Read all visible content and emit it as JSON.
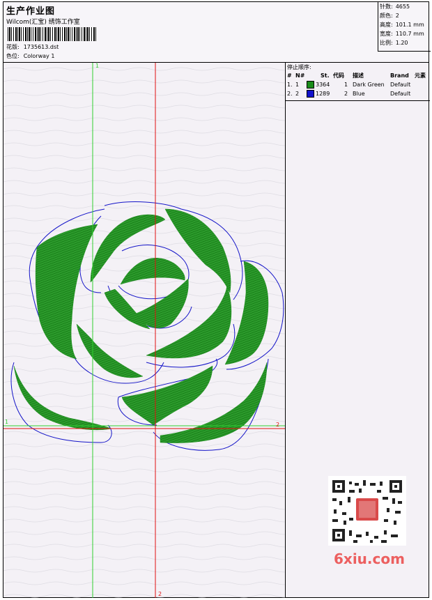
{
  "header": {
    "title": "生产作业图",
    "subtitle": "Wilcom(汇宝) 绣饰工作室",
    "design_label": "花版:",
    "design_value": "1735613.dst",
    "colorway_label": "色位:",
    "colorway_value": "Colorway 1"
  },
  "info": {
    "stitches_label": "针数:",
    "stitches_value": "4655",
    "colors_label": "颜色:",
    "colors_value": "2",
    "height_label": "高度:",
    "height_value": "101.1 mm",
    "width_label": "宽度:",
    "width_value": "110.7 mm",
    "ratio_label": "比例:",
    "ratio_value": "1.20"
  },
  "stop_sequence": {
    "title": "停止顺序:",
    "columns": [
      "#",
      "N#",
      "St.",
      "代码",
      "描述",
      "Brand",
      "元素"
    ],
    "rows": [
      {
        "num": "1.",
        "n": "1",
        "color": "#1a8c1a",
        "st": "3364",
        "code": "1",
        "desc": "Dark Green",
        "brand": "Default"
      },
      {
        "num": "2.",
        "n": "2",
        "color": "#1212cc",
        "st": "1289",
        "code": "2",
        "desc": "Blue",
        "brand": "Default"
      }
    ]
  },
  "canvas": {
    "axis_labels": {
      "green_top": "1",
      "green_left": "1",
      "red_right": "2",
      "red_bottom": "2"
    },
    "colors": {
      "fill": "#1f8f1f",
      "outline": "#1414c8",
      "green_axis": "#2fd02f",
      "red_axis": "#e01010"
    }
  },
  "watermark": {
    "text": "6xiu.com",
    "qr_icon": "qr-code-icon"
  }
}
